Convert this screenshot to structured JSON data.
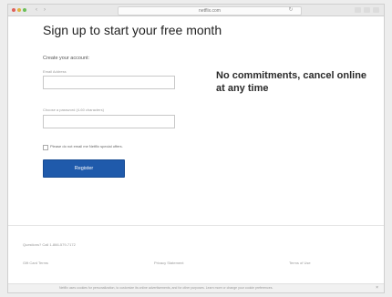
{
  "browser": {
    "address": "netflix.com",
    "back_glyph": "‹",
    "forward_glyph": "›",
    "reload_glyph": "↻"
  },
  "signup": {
    "title": "Sign up to start your free month",
    "create_account_label": "Create your account:",
    "email_label": "Email Address",
    "email_value": "",
    "password_label": "Choose a password (4-60 characters)",
    "password_value": "",
    "checkbox_label": "Please do not email me Netflix special offers.",
    "checkbox_checked": false,
    "register_label": "Register"
  },
  "promo": {
    "headline": "No commitments, cancel online at any time"
  },
  "footer": {
    "questions": "Questions? Call 1-866-579-7172",
    "links": [
      "Gift Card Terms",
      "Privacy Statement",
      "Terms of Use"
    ]
  },
  "cookie": {
    "text": "Netflix uses cookies for personalization, to customize its online advertisements, and for other purposes. Learn more or change your cookie preferences.",
    "close_glyph": "×"
  },
  "colors": {
    "register_button": "#1f5aab",
    "page_background": "#ffffff"
  }
}
